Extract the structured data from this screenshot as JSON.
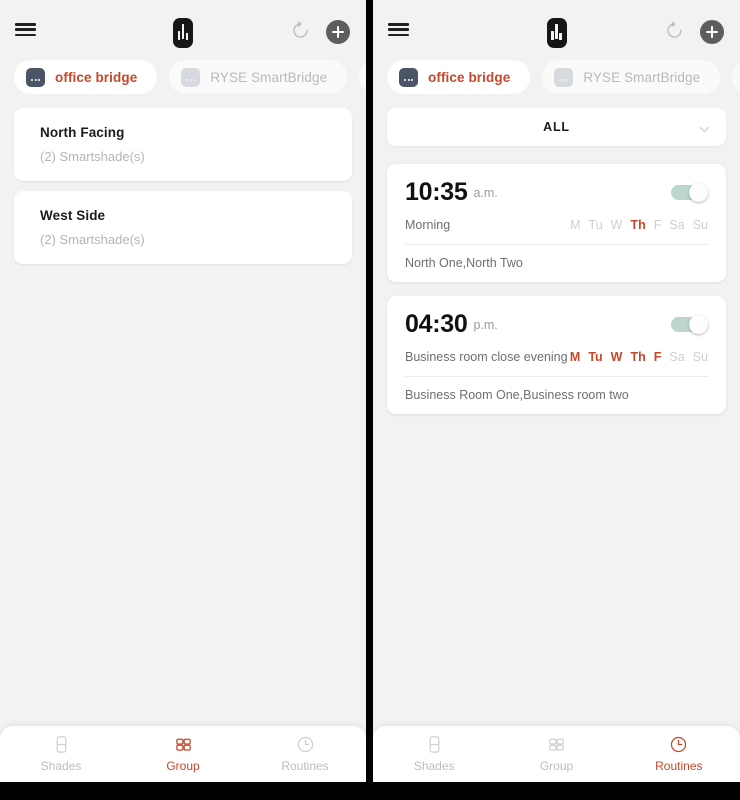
{
  "accent": "#C8472B",
  "muted": "#BDBDBD",
  "background": "#F2F2F2",
  "toggle_track": "#BCD6CF",
  "header": {
    "menu_icon": "hamburger-menu-icon",
    "logo_icon": "ryse-blinds-logo-icon",
    "refresh_icon": "refresh-icon",
    "add_icon": "plus-add-icon"
  },
  "bridges": [
    {
      "label": "office bridge",
      "active": true,
      "icon": "bridge-device-icon"
    },
    {
      "label": "RYSE SmartBridge",
      "active": false,
      "icon": "bridge-device-icon"
    },
    {
      "label": "",
      "active": false,
      "icon": "bridge-device-icon"
    }
  ],
  "left_screen": {
    "tab": "Group",
    "groups": [
      {
        "name": "North Facing",
        "subtitle": "(2) Smartshade(s)"
      },
      {
        "name": "West Side",
        "subtitle": "(2) Smartshade(s)"
      }
    ]
  },
  "right_screen": {
    "tab": "Routines",
    "filter": {
      "label": "ALL",
      "chevron_icon": "chevron-down-icon"
    },
    "day_labels": [
      "M",
      "Tu",
      "W",
      "Th",
      "F",
      "Sa",
      "Su"
    ],
    "routines": [
      {
        "time": "10:35",
        "meridiem": "a.m.",
        "enabled": true,
        "name": "Morning",
        "days_active": [
          "Th"
        ],
        "shades": "North One,North Two"
      },
      {
        "time": "04:30",
        "meridiem": "p.m.",
        "enabled": true,
        "name": "Business room close evening",
        "days_active": [
          "M",
          "Tu",
          "W",
          "Th",
          "F"
        ],
        "shades": "Business Room One,Business room two"
      }
    ]
  },
  "bottom_nav": {
    "items": [
      {
        "label": "Shades",
        "icon": "shade-blind-icon"
      },
      {
        "label": "Group",
        "icon": "group-grid-icon"
      },
      {
        "label": "Routines",
        "icon": "clock-routine-icon"
      }
    ]
  }
}
